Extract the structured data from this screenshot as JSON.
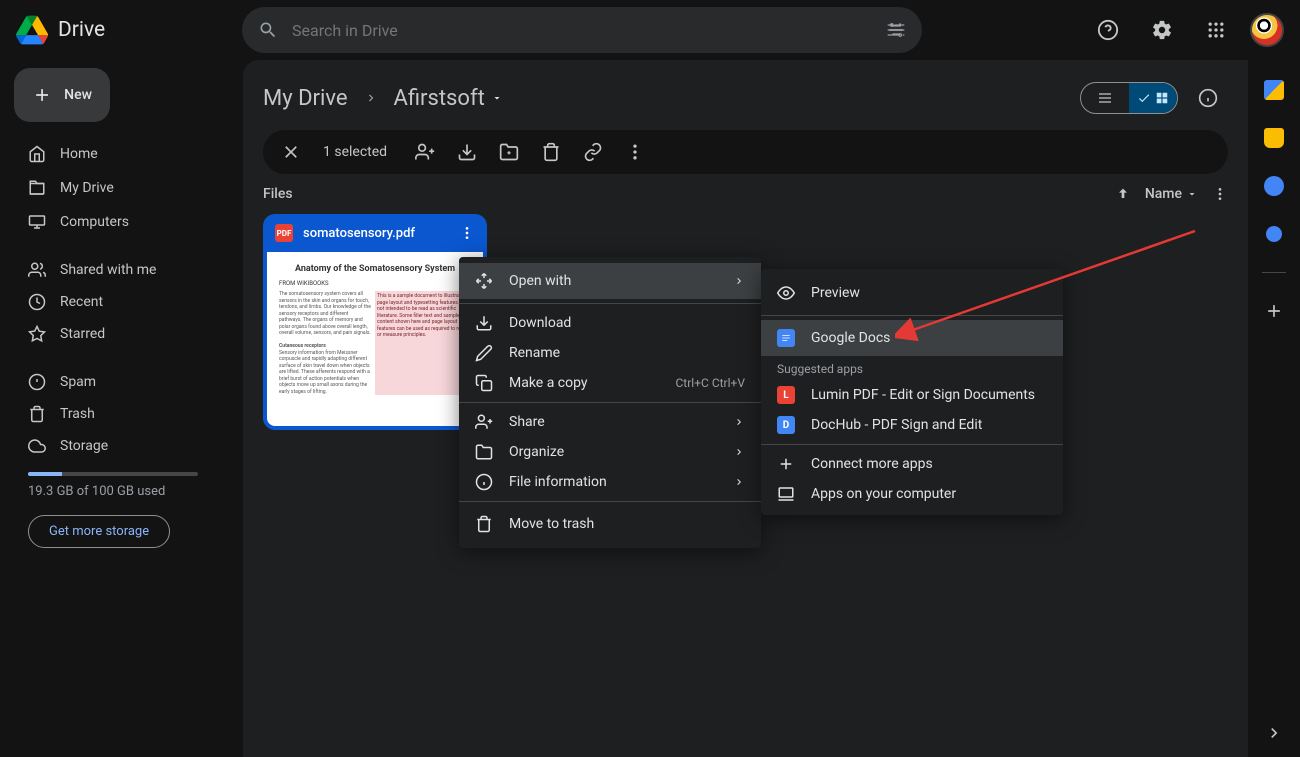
{
  "header": {
    "app_name": "Drive",
    "search_placeholder": "Search in Drive"
  },
  "sidebar": {
    "new_label": "New",
    "items": [
      {
        "label": "Home"
      },
      {
        "label": "My Drive"
      },
      {
        "label": "Computers"
      },
      {
        "label": "Shared with me"
      },
      {
        "label": "Recent"
      },
      {
        "label": "Starred"
      },
      {
        "label": "Spam"
      },
      {
        "label": "Trash"
      },
      {
        "label": "Storage"
      }
    ],
    "storage_used": "19.3 GB of 100 GB used",
    "storage_cta": "Get more storage"
  },
  "breadcrumb": {
    "root": "My Drive",
    "current": "Afirstsoft"
  },
  "selection": {
    "count": "1 selected"
  },
  "files": {
    "heading": "Files",
    "sort_label": "Name",
    "card": {
      "name": "somatosensory.pdf",
      "thumb_title": "Anatomy of the Somatosensory System",
      "thumb_author": "FROM WIKIBOOKS"
    }
  },
  "context_menu": {
    "open_with": "Open with",
    "download": "Download",
    "rename": "Rename",
    "make_copy": "Make a copy",
    "copy_shortcut": "Ctrl+C Ctrl+V",
    "share": "Share",
    "organize": "Organize",
    "file_info": "File information",
    "trash": "Move to trash"
  },
  "submenu": {
    "preview": "Preview",
    "google_docs": "Google Docs",
    "suggested": "Suggested apps",
    "lumin": "Lumin PDF - Edit or Sign Documents",
    "dochub": "DocHub - PDF Sign and Edit",
    "connect": "Connect more apps",
    "computer": "Apps on your computer"
  }
}
